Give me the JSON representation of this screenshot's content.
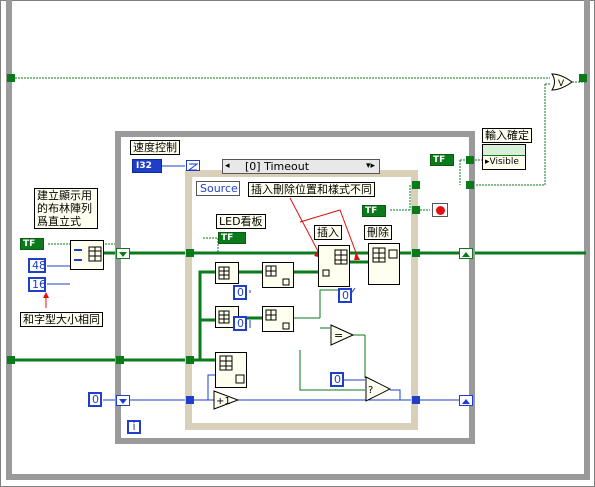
{
  "labels": {
    "build_display": "建立顯示用\n的布林陣列\n爲直立式",
    "same_size": "和字型大小相同",
    "speed_control": "速度控制",
    "led_board": "LED看板",
    "insert": "插入",
    "delete": "刪除",
    "insert_delete_diff": "插入刪除位置和樣式不同",
    "input_confirm": "輸入確定"
  },
  "event_case": {
    "selector": "[0] Timeout",
    "source": "Source"
  },
  "constants": {
    "rows": "48",
    "cols": "16",
    "zero_a": "0",
    "zero_b": "0",
    "zero_c": "0",
    "zero_d": "0",
    "i32": "I32",
    "visible": "Visible",
    "tf": "TF",
    "plus_one": "+1",
    "iter": "i"
  },
  "colors": {
    "bool_wire": "#0a7a1a",
    "num_wire": "#1f3fc8",
    "loop_border": "#9a9a9a",
    "case_border": "#d8d0b8"
  }
}
